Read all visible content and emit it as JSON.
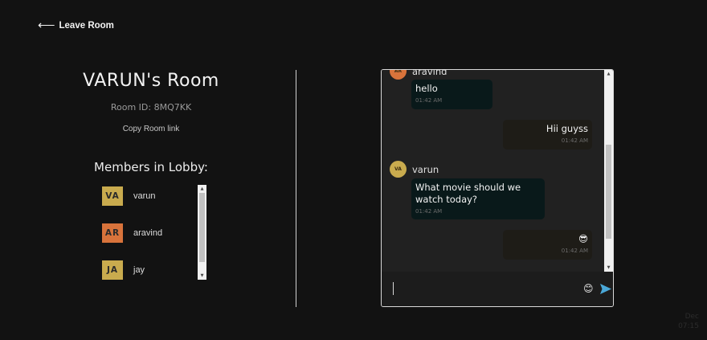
{
  "nav": {
    "arrow": "⟵",
    "leave_label": "Leave Room"
  },
  "room": {
    "title": "VARUN's Room",
    "room_id": "Room ID: 8MQ7KK",
    "copy_link": "Copy Room link",
    "members_title": "Members in Lobby:"
  },
  "members": [
    {
      "initials": "VA",
      "name": "varun",
      "color": "#c9ab4e"
    },
    {
      "initials": "AR",
      "name": "aravind",
      "color": "#d8733b"
    },
    {
      "initials": "JA",
      "name": "jay",
      "color": "#c9ab4e"
    }
  ],
  "chat": {
    "messages": [
      {
        "kind": "sender",
        "initials": "AR",
        "name": "aravind",
        "color": "#d8733b"
      },
      {
        "kind": "in",
        "text": "hello",
        "time": "01:42 AM"
      },
      {
        "kind": "out",
        "text": "Hii guyss",
        "time": "01:42 AM"
      },
      {
        "kind": "sender",
        "initials": "VA",
        "name": "varun",
        "color": "#c9ab4e"
      },
      {
        "kind": "in",
        "text": "What movie should we watch today?",
        "time": "01:42 AM"
      },
      {
        "kind": "out",
        "text": "😎",
        "time": "01:42 AM"
      }
    ],
    "input_value": "",
    "emoji_icon": "emoji-icon",
    "send_icon": "send-icon",
    "send_color": "#4aa8d8"
  },
  "system": {
    "line1": "Dec",
    "line2": "07:15"
  }
}
